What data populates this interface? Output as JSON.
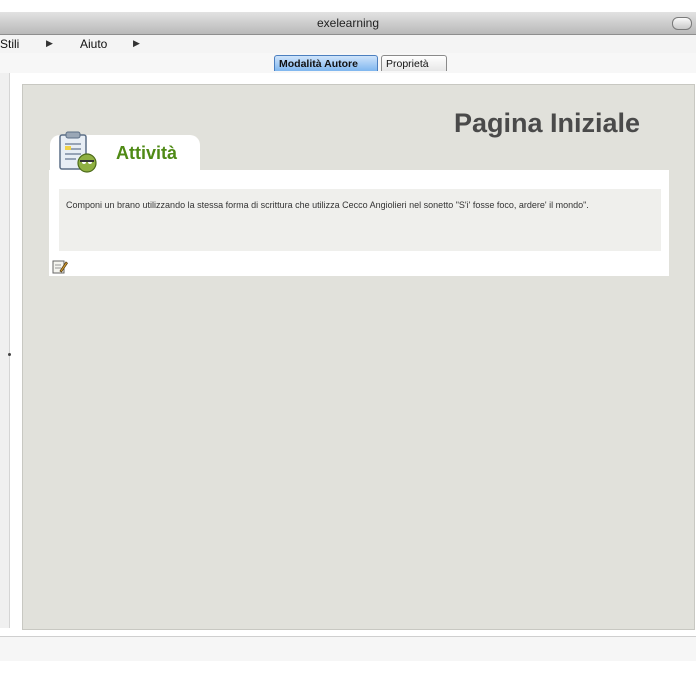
{
  "window": {
    "title": "exelearning"
  },
  "menu": {
    "items": [
      {
        "label": "Stili"
      },
      {
        "label": "Aiuto"
      }
    ]
  },
  "tabs": [
    {
      "label": "Modalità Autore"
    },
    {
      "label": "Proprietà"
    }
  ],
  "page": {
    "title": "Pagina Iniziale"
  },
  "idevice": {
    "title": "Attività",
    "text": "Componi un brano utilizzando la stessa forma di scrittura che utilizza Cecco Angiolieri nel sonetto \"S'i' fosse foco, ardere' il mondo\"."
  },
  "icons": {
    "activity": "clipboard-activity-icon",
    "edit": "edit-pencil-icon",
    "menu_arrow": "triangle-right-icon",
    "window_zoom": "zoom-button-icon"
  },
  "colors": {
    "accent_green": "#4f8a15",
    "content_bg": "#e1e1db",
    "active_tab": "#7fb6ef"
  }
}
